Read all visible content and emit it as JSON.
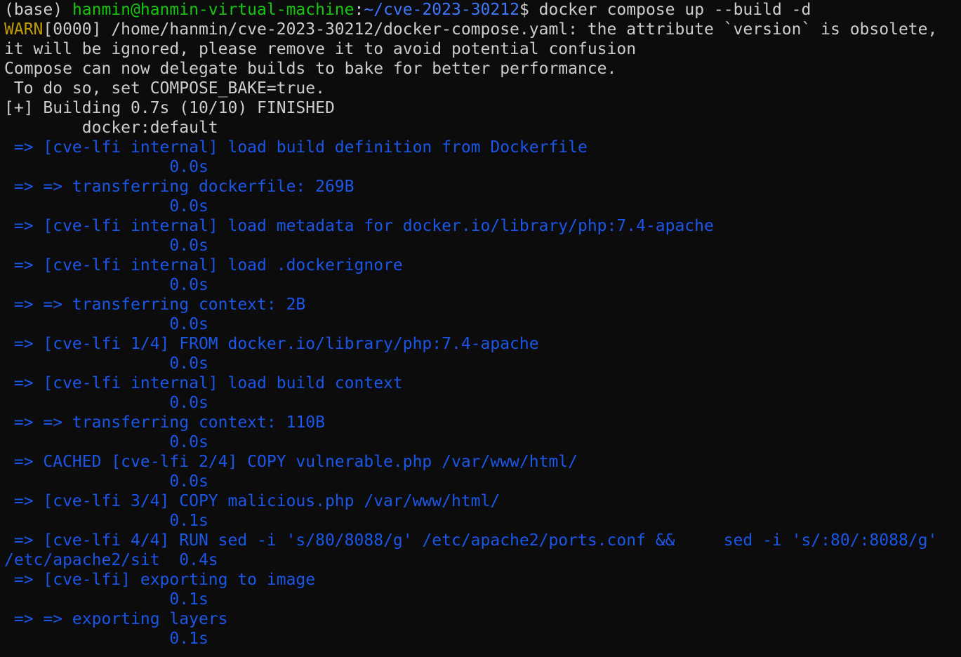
{
  "colors": {
    "background": "#0c0c0c",
    "foreground": "#cccccc",
    "prompt_user": "#16c60c",
    "prompt_path": "#3b78ff",
    "warn": "#c19c00",
    "build_steps": "#1a56e8"
  },
  "prompt": {
    "env": "(base) ",
    "user_host": "hanmin@hanmin-virtual-machine",
    "colon": ":",
    "path": "~/cve-2023-30212",
    "symbol": "$ ",
    "command": "docker compose up --build -d"
  },
  "warn": {
    "tag": "WARN",
    "line1_rest": "[0000] /home/hanmin/cve-2023-30212/docker-compose.yaml: the attribute `version` is obsolete,",
    "line2": "it will be ignored, please remove it to avoid potential confusion"
  },
  "info": {
    "bake_line1": "Compose can now delegate builds to bake for better performance.",
    "bake_line2": " To do so, set COMPOSE_BAKE=true.",
    "building": "[+] Building 0.7s (10/10) FINISHED",
    "builder": "        docker:default"
  },
  "steps": [
    {
      "text": " => [cve-lfi internal] load build definition from Dockerfile",
      "time": "                 0.0s"
    },
    {
      "text": " => => transferring dockerfile: 269B",
      "time": "                 0.0s"
    },
    {
      "text": " => [cve-lfi internal] load metadata for docker.io/library/php:7.4-apache",
      "time": "                 0.0s"
    },
    {
      "text": " => [cve-lfi internal] load .dockerignore",
      "time": "                 0.0s"
    },
    {
      "text": " => => transferring context: 2B",
      "time": "                 0.0s"
    },
    {
      "text": " => [cve-lfi 1/4] FROM docker.io/library/php:7.4-apache",
      "time": "                 0.0s"
    },
    {
      "text": " => [cve-lfi internal] load build context",
      "time": "                 0.0s"
    },
    {
      "text": " => => transferring context: 110B",
      "time": "                 0.0s"
    },
    {
      "text": " => CACHED [cve-lfi 2/4] COPY vulnerable.php /var/www/html/",
      "time": "                 0.0s"
    },
    {
      "text": " => [cve-lfi 3/4] COPY malicious.php /var/www/html/",
      "time": "                 0.1s"
    },
    {
      "text": " => [cve-lfi 4/4] RUN sed -i 's/80/8088/g' /etc/apache2/ports.conf &&     sed -i 's/:80/:8088/g'",
      "time": "/etc/apache2/sit  0.4s"
    },
    {
      "text": " => [cve-lfi] exporting to image",
      "time": "                 0.1s"
    },
    {
      "text": " => => exporting layers",
      "time": "                 0.1s"
    }
  ]
}
